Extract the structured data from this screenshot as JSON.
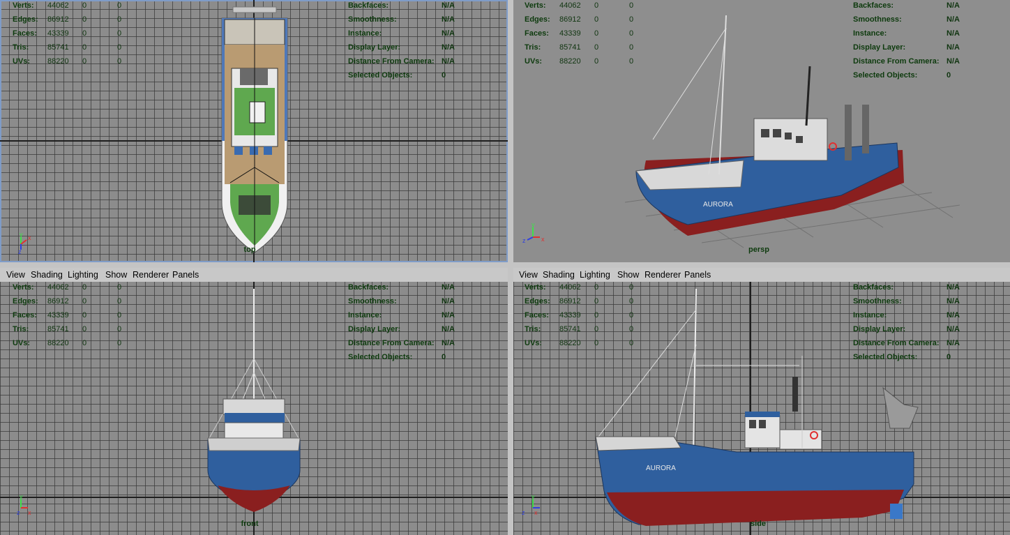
{
  "menu": [
    "View",
    "Shading",
    "Lighting",
    "Show",
    "Renderer",
    "Panels"
  ],
  "hud_stats": {
    "rows": [
      {
        "label": "Verts:",
        "total": "44062",
        "sel": "0",
        "comp": "0"
      },
      {
        "label": "Edges:",
        "total": "86912",
        "sel": "0",
        "comp": "0"
      },
      {
        "label": "Faces:",
        "total": "43339",
        "sel": "0",
        "comp": "0"
      },
      {
        "label": "Tris:",
        "total": "85741",
        "sel": "0",
        "comp": "0"
      },
      {
        "label": "UVs:",
        "total": "88220",
        "sel": "0",
        "comp": "0"
      }
    ]
  },
  "hud_info": {
    "rows": [
      {
        "label": "Backfaces:",
        "value": "N/A"
      },
      {
        "label": "Smoothness:",
        "value": "N/A"
      },
      {
        "label": "Instance:",
        "value": "N/A"
      },
      {
        "label": "Display Layer:",
        "value": "N/A"
      },
      {
        "label": "Distance From Camera:",
        "value": "N/A"
      },
      {
        "label": "Selected Objects:",
        "value": "0"
      }
    ]
  },
  "viewports": {
    "top": {
      "camera": "top"
    },
    "persp": {
      "camera": "persp"
    },
    "front": {
      "camera": "front"
    },
    "side": {
      "camera": "side"
    }
  },
  "boat": {
    "name": "AURORA"
  },
  "colors": {
    "hull_blue": "#2f5f9e",
    "hull_red": "#8a1f1f",
    "deck_green": "#5fa84f",
    "deck_wood": "#b99b72",
    "active_border": "#7f9cc8"
  }
}
